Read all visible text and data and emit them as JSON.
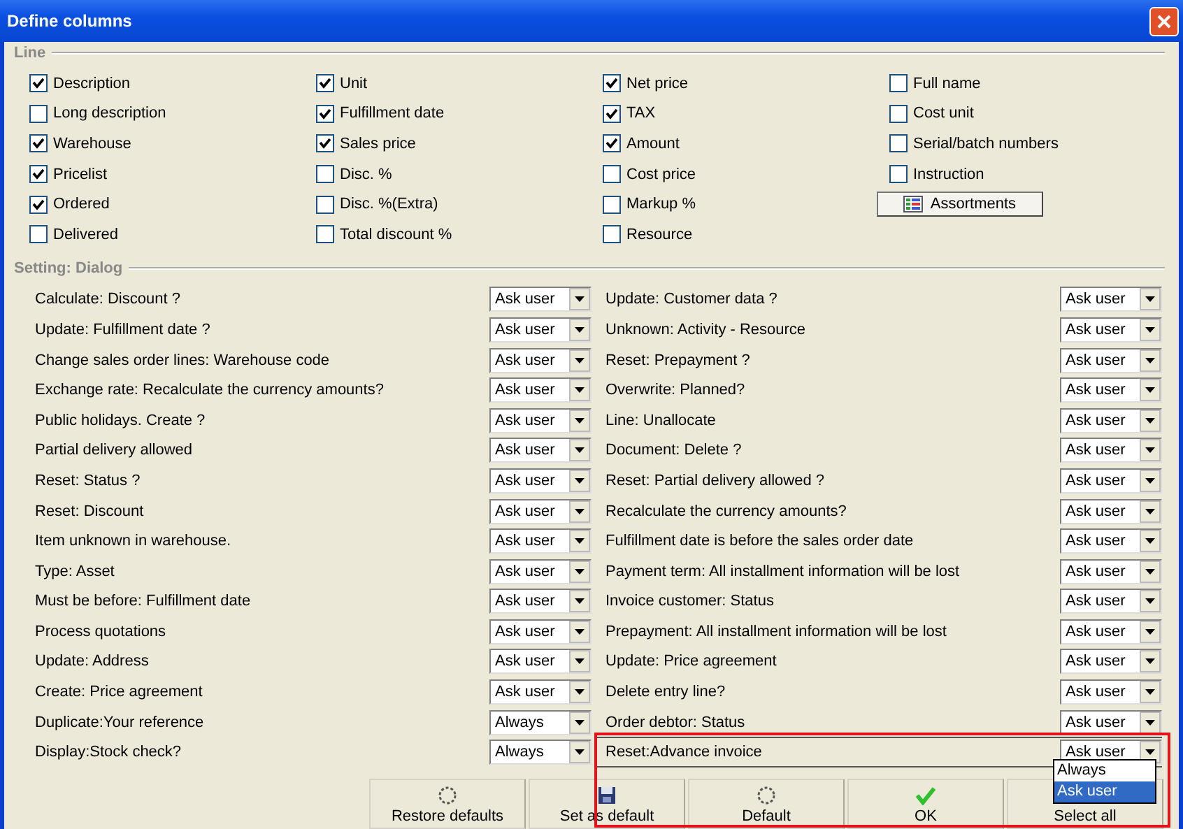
{
  "window": {
    "title": "Define columns"
  },
  "line": {
    "title": "Line",
    "columns": [
      [
        {
          "label": "Description",
          "checked": true
        },
        {
          "label": "Long description",
          "checked": false
        },
        {
          "label": "Warehouse",
          "checked": true
        },
        {
          "label": "Pricelist",
          "checked": true
        },
        {
          "label": "Ordered",
          "checked": true
        },
        {
          "label": "Delivered",
          "checked": false
        }
      ],
      [
        {
          "label": "Unit",
          "checked": true
        },
        {
          "label": "Fulfillment date",
          "checked": true
        },
        {
          "label": "Sales price",
          "checked": true
        },
        {
          "label": "Disc. %",
          "checked": false
        },
        {
          "label": "Disc. %(Extra)",
          "checked": false
        },
        {
          "label": "Total discount %",
          "checked": false
        }
      ],
      [
        {
          "label": "Net price",
          "checked": true
        },
        {
          "label": "TAX",
          "checked": true
        },
        {
          "label": "Amount",
          "checked": true
        },
        {
          "label": "Cost price",
          "checked": false
        },
        {
          "label": "Markup %",
          "checked": false
        },
        {
          "label": "Resource",
          "checked": false
        }
      ],
      [
        {
          "label": "Full name",
          "checked": false
        },
        {
          "label": "Cost unit",
          "checked": false
        },
        {
          "label": "Serial/batch numbers",
          "checked": false
        },
        {
          "label": "Instruction",
          "checked": false
        }
      ]
    ],
    "assortments_button": "Assortments"
  },
  "settings": {
    "title": "Setting: Dialog",
    "columns": [
      [
        {
          "label": "Calculate: Discount ?",
          "value": "Ask user",
          "selected": false
        },
        {
          "label": "Update: Fulfillment date ?",
          "value": "Ask user",
          "selected": false
        },
        {
          "label": "Change sales order lines: Warehouse code",
          "value": "Ask user",
          "selected": false
        },
        {
          "label": "Exchange rate: Recalculate the currency amounts?",
          "value": "Ask user",
          "selected": false
        },
        {
          "label": "Public holidays. Create ?",
          "value": "Ask user",
          "selected": false
        },
        {
          "label": "Partial delivery allowed",
          "value": "Ask user",
          "selected": false
        },
        {
          "label": "Reset: Status ?",
          "value": "Ask user",
          "selected": false
        },
        {
          "label": "Reset: Discount",
          "value": "Ask user",
          "selected": false
        },
        {
          "label": "Item unknown in warehouse.",
          "value": "Ask user",
          "selected": false
        },
        {
          "label": "Type: Asset",
          "value": "Ask user",
          "selected": false
        },
        {
          "label": "Must be before: Fulfillment date",
          "value": "Ask user",
          "selected": false
        },
        {
          "label": "Process quotations",
          "value": "Ask user",
          "selected": false
        },
        {
          "label": "Update: Address",
          "value": "Ask user",
          "selected": false
        },
        {
          "label": "Create: Price agreement",
          "value": "Ask user",
          "selected": false
        },
        {
          "label": "Duplicate:Your reference",
          "value": "Always",
          "selected": false
        },
        {
          "label": "Display:Stock check?",
          "value": "Always",
          "selected": false
        }
      ],
      [
        {
          "label": "Update: Customer data ?",
          "value": "Ask user",
          "selected": false
        },
        {
          "label": "Unknown: Activity - Resource",
          "value": "Ask user",
          "selected": false
        },
        {
          "label": "Reset: Prepayment ?",
          "value": "Ask user",
          "selected": false
        },
        {
          "label": "Overwrite: Planned?",
          "value": "Ask user",
          "selected": false
        },
        {
          "label": "Line: Unallocate",
          "value": "Ask user",
          "selected": false
        },
        {
          "label": "Document: Delete ?",
          "value": "Ask user",
          "selected": false
        },
        {
          "label": "Reset: Partial delivery allowed ?",
          "value": "Ask user",
          "selected": false
        },
        {
          "label": "Recalculate the currency amounts?",
          "value": "Ask user",
          "selected": false
        },
        {
          "label": "Fulfillment date is before the sales order date",
          "value": "Ask user",
          "selected": false
        },
        {
          "label": "Payment term: All installment information will be lost",
          "value": "Ask user",
          "selected": false
        },
        {
          "label": "Invoice customer: Status",
          "value": "Ask user",
          "selected": false
        },
        {
          "label": "Prepayment: All installment information will be lost",
          "value": "Ask user",
          "selected": false
        },
        {
          "label": "Update: Price agreement",
          "value": "Ask user",
          "selected": false
        },
        {
          "label": "Delete entry line?",
          "value": "Ask user",
          "selected": false
        },
        {
          "label": "Order debtor: Status",
          "value": "Ask user",
          "selected": false
        },
        {
          "label": "Reset:Advance invoice",
          "value": "Ask user",
          "selected": true,
          "options": [
            {
              "label": "Always",
              "selected": false
            },
            {
              "label": "Ask user",
              "selected": true
            }
          ]
        }
      ]
    ]
  },
  "buttons": [
    {
      "kind": "restore",
      "label": "Restore defaults"
    },
    {
      "kind": "save",
      "label": "Set as default"
    },
    {
      "kind": "restore",
      "label": "Default"
    },
    {
      "kind": "ok",
      "label": "OK"
    },
    {
      "kind": "none",
      "label": "Select all"
    }
  ]
}
